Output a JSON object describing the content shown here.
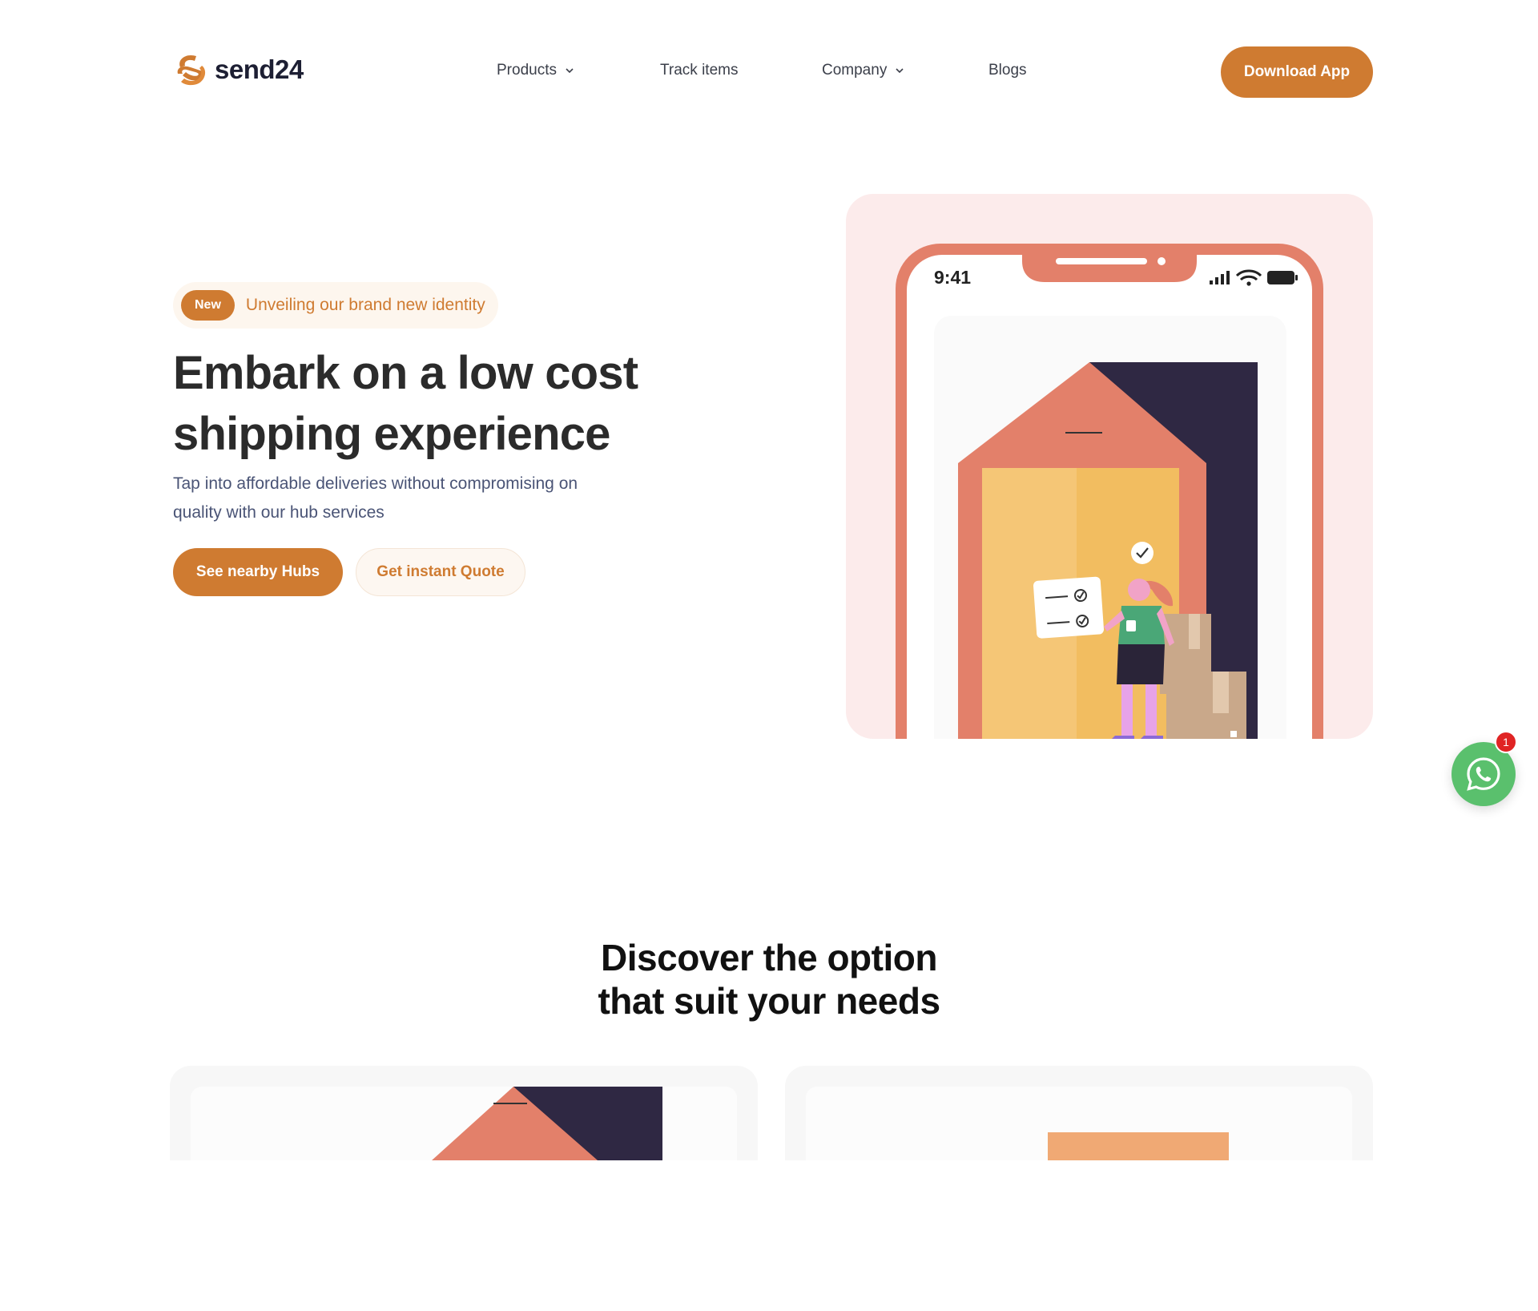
{
  "brand": {
    "name": "send24",
    "accent": "#cf7b31"
  },
  "nav": {
    "items": [
      {
        "label": "Products",
        "has_dropdown": true
      },
      {
        "label": "Track items",
        "has_dropdown": false
      },
      {
        "label": "Company",
        "has_dropdown": true
      },
      {
        "label": "Blogs",
        "has_dropdown": false
      }
    ],
    "cta": "Download App"
  },
  "hero": {
    "badge_tag": "New",
    "badge_text": "Unveiling our brand new identity",
    "title_line1": "Embark on a low cost",
    "title_line2": "shipping experience",
    "subtitle": "Tap into affordable deliveries without compromising on quality with our hub services",
    "primary_button": "See nearby Hubs",
    "secondary_button": "Get instant Quote",
    "phone_time": "9:41"
  },
  "whatsapp": {
    "icon": "whatsapp-icon",
    "unread": "1"
  },
  "section": {
    "title_line1": "Discover the option",
    "title_line2": "that suit your needs"
  }
}
